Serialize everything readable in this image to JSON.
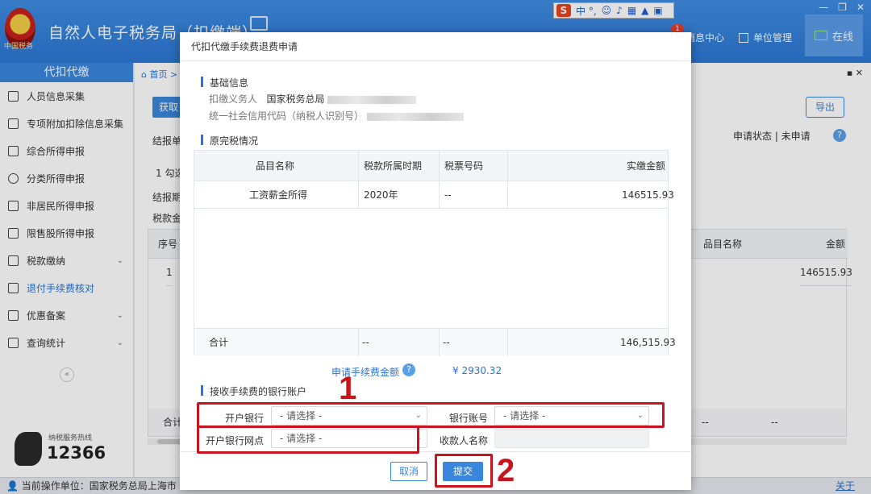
{
  "header": {
    "app_title": "自然人电子税务局（扣缴端）",
    "logo_sub": "中国税务",
    "msg_badge": "1",
    "msg_center": "消息中心",
    "unit_mgmt": "单位管理",
    "online": "在线",
    "ime_text": "中 °,"
  },
  "sidebar": {
    "title": "代扣代缴",
    "items": [
      {
        "label": "人员信息采集",
        "icon": "person-icon"
      },
      {
        "label": "专项附加扣除信息采集",
        "icon": "list-icon"
      },
      {
        "label": "综合所得申报",
        "icon": "layers-icon"
      },
      {
        "label": "分类所得申报",
        "icon": "pie-icon"
      },
      {
        "label": "非居民所得申报",
        "icon": "person-icon"
      },
      {
        "label": "限售股所得申报",
        "icon": "bars-icon"
      },
      {
        "label": "税款缴纳",
        "icon": "folder-icon"
      },
      {
        "label": "退付手续费核对",
        "icon": "doc-icon"
      },
      {
        "label": "优惠备案",
        "icon": "copy-icon"
      },
      {
        "label": "查询统计",
        "icon": "search-list-icon"
      }
    ],
    "collapse": "«",
    "hotline_label": "纳税服务热线",
    "hotline_number": "12366"
  },
  "main": {
    "breadcrumb_home": "首页 >",
    "btn_get": "获取",
    "label_1": "结报单",
    "label_2": "1 勾选",
    "label_3": "结报期",
    "label_4": "税款金",
    "export": "导出",
    "status": "申请状态  |  未申请",
    "table_headers": {
      "seq": "序号",
      "item": "品目名称",
      "amount": "金额"
    },
    "row_seq": "1",
    "row_amount": "146515.93",
    "total_label": "合计",
    "total_dash_1": "--",
    "total_dash_2": "--"
  },
  "statusbar": {
    "current_unit": "当前操作单位：国家税务总局上海市",
    "about": "关于"
  },
  "modal": {
    "title": "代扣代缴手续费退费申请",
    "section_basic": "基础信息",
    "withholder_label": "扣缴义务人",
    "withholder_value": "国家税务总局",
    "credit_code_label": "统一社会信用代码（纳税人识别号）",
    "section_original": "原完税情况",
    "table": {
      "headers": [
        "品目名称",
        "税款所属时期",
        "税票号码",
        "实缴金额"
      ],
      "rows": [
        [
          "工资薪金所得",
          "2020年",
          "--",
          "146515.93"
        ]
      ],
      "total": [
        "合计",
        "--",
        "--",
        "146,515.93"
      ]
    },
    "fee_label": "申请手续费金额",
    "fee_value": "¥ 2930.32",
    "section_bank": "接收手续费的银行账户",
    "bank_label": "开户银行",
    "bank_placeholder": "- 请选择 -",
    "account_label": "银行账号",
    "account_placeholder": "- 请选择 -",
    "branch_label": "开户银行网点",
    "branch_placeholder": "- 请选择 -",
    "payee_label": "收款人名称",
    "cancel": "取消",
    "submit": "提交"
  },
  "annotations": {
    "box1": "1",
    "box2": "2",
    "color": "#c9141e"
  }
}
